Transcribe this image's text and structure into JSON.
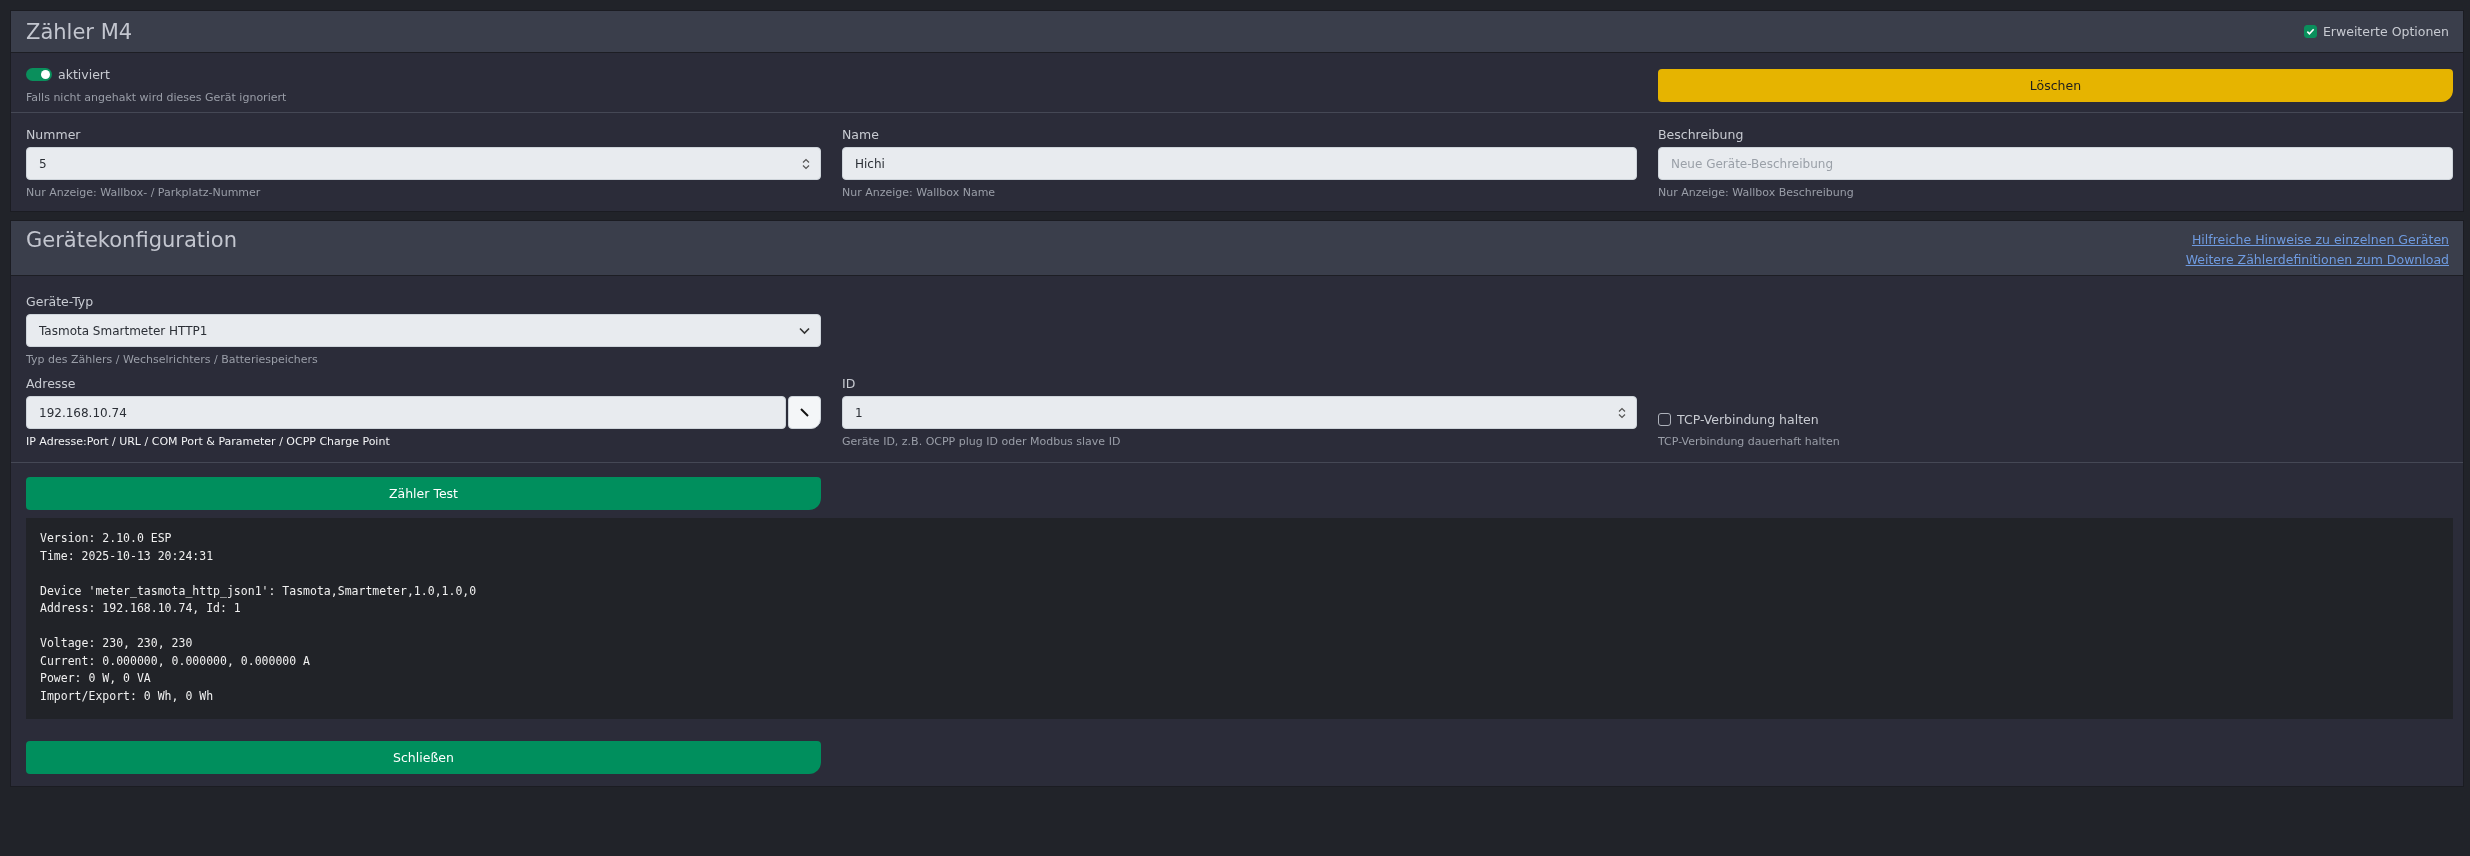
{
  "device_card": {
    "title": "Zähler M4",
    "advanced_options": {
      "label": "Erweiterte Optionen",
      "checked": true
    },
    "enabled": {
      "label": "aktiviert",
      "on": true,
      "hint": "Falls nicht angehakt wird dieses Gerät ignoriert"
    },
    "delete_button": "Löschen",
    "fields": [
      {
        "kind": "number",
        "label": "Nummer",
        "value": "5",
        "hint": "Nur Anzeige: Wallbox- / Parkplatz-Nummer"
      },
      {
        "kind": "text",
        "label": "Name",
        "value": "Hichi",
        "hint": "Nur Anzeige: Wallbox Name"
      },
      {
        "kind": "text",
        "label": "Beschreibung",
        "placeholder": "Neue Geräte-Beschreibung",
        "hint": "Nur Anzeige: Wallbox Beschreibung"
      }
    ]
  },
  "config_card": {
    "title": "Gerätekonfiguration",
    "links": [
      "Hilfreiche Hinweise zu einzelnen Geräten",
      "Weitere Zählerdefinitionen zum Download"
    ],
    "device_type": {
      "label": "Geräte-Typ",
      "value": "Tasmota Smartmeter HTTP1",
      "hint": "Typ des Zählers / Wechselrichters / Batteriespeichers"
    },
    "address": {
      "label": "Adresse",
      "value": "192.168.10.74",
      "hint": "IP Adresse:Port / URL / COM Port & Parameter / OCPP Charge Point"
    },
    "id_field": {
      "label": "ID",
      "value": "1",
      "hint": "Geräte ID, z.B. OCPP plug ID oder Modbus slave ID"
    },
    "keep_tcp": {
      "label": "TCP-Verbindung halten",
      "checked": false,
      "hint": "TCP-Verbindung dauerhaft halten"
    },
    "test_button": "Zähler Test",
    "output": [
      [
        "Version: 2.10.0 ESP",
        "Time: 2025-10-13 20:24:31"
      ],
      [
        "Device 'meter_tasmota_http_json1': Tasmota,Smartmeter,1.0,1.0,0",
        "Address: 192.168.10.74, Id: 1"
      ],
      [
        "Voltage: 230, 230, 230",
        "Current: 0.000000, 0.000000, 0.000000 A",
        "Power: 0 W, 0 VA",
        "Import/Export: 0 Wh, 0 Wh"
      ]
    ],
    "close_button": "Schließen"
  }
}
